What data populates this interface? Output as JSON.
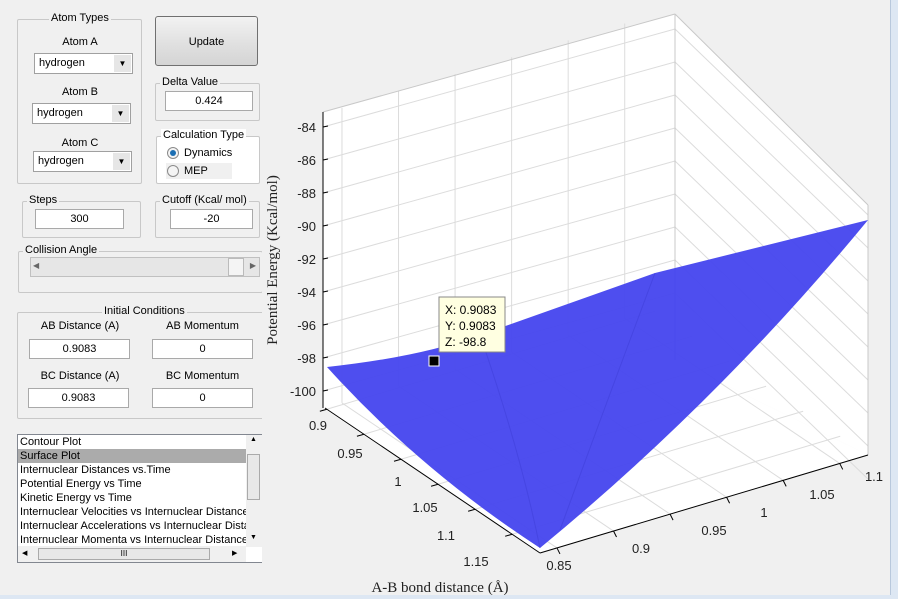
{
  "atom_types": {
    "title": "Atom Types",
    "atom_a_label": "Atom A",
    "atom_a": "hydrogen",
    "atom_b_label": "Atom B",
    "atom_b": "hydrogen",
    "atom_c_label": "Atom C",
    "atom_c": "hydrogen"
  },
  "update_label": "Update",
  "delta": {
    "title": "Delta Value",
    "value": "0.424"
  },
  "calc": {
    "title": "Calculation Type",
    "dynamics": "Dynamics",
    "mep": "MEP",
    "selected": "Dynamics"
  },
  "steps": {
    "title": "Steps",
    "value": "300"
  },
  "cutoff": {
    "title": "Cutoff (Kcal/ mol)",
    "value": "-20"
  },
  "collision": {
    "title": "Collision Angle",
    "value_fraction": 1.0
  },
  "initial": {
    "title": "Initial Conditions",
    "ab_dist_label": "AB Distance (A)",
    "ab_dist": "0.9083",
    "ab_mom_label": "AB Momentum",
    "ab_mom": "0",
    "bc_dist_label": "BC Distance (A)",
    "bc_dist": "0.9083",
    "bc_mom_label": "BC Momentum",
    "bc_mom": "0"
  },
  "plot_list": {
    "items": [
      "Contour Plot",
      "Surface Plot",
      "Internuclear Distances vs.Time",
      "Potential Energy vs Time",
      "Kinetic Energy vs Time",
      "Internuclear Velocities vs Internuclear Distance",
      "Internuclear Accelerations vs Internuclear Dista",
      "Internuclear Momenta vs Internuclear Distance"
    ],
    "selected_index": 1,
    "hscroll_grip": "III"
  },
  "chart_data": {
    "type": "surface",
    "xlabel": "A-B bond distance (Å)",
    "zlabel": "Potential Energy (Kcal/mol)",
    "x_ticks": [
      "0.9",
      "0.95",
      "1",
      "1.05",
      "1.1",
      "1.15"
    ],
    "y_ticks": [
      "0.85",
      "0.9",
      "0.95",
      "1",
      "1.05",
      "1.1"
    ],
    "z_ticks": [
      "-84",
      "-86",
      "-88",
      "-90",
      "-92",
      "-94",
      "-96",
      "-98",
      "-100"
    ],
    "zlim": [
      -101,
      -83
    ],
    "surface_color": "#4444ee",
    "datatip": {
      "x": "X: 0.9083",
      "y": "Y: 0.9083",
      "z": "Z: -98.8"
    }
  }
}
